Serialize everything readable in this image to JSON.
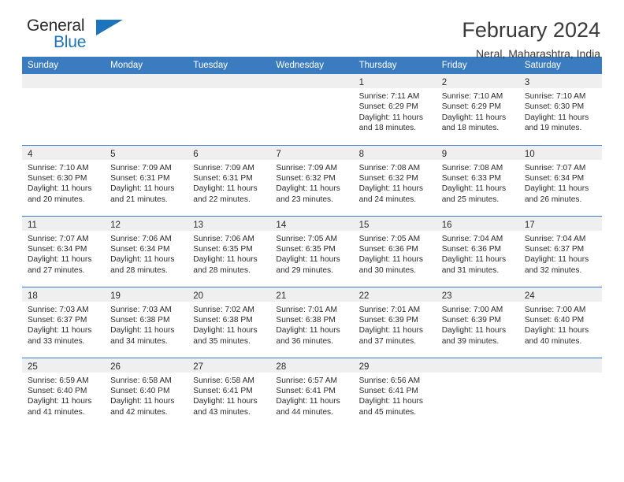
{
  "brand": {
    "name_part1": "General",
    "name_part2": "Blue"
  },
  "header": {
    "title": "February 2024",
    "subtitle": "Neral, Maharashtra, India"
  },
  "colors": {
    "header_blue": "#3b7cc0",
    "daynum_band": "#efefef",
    "brand_blue": "#1c75bc",
    "text": "#2b2b2b"
  },
  "weekday_headers": [
    "Sunday",
    "Monday",
    "Tuesday",
    "Wednesday",
    "Thursday",
    "Friday",
    "Saturday"
  ],
  "weeks": [
    [
      {
        "empty": true
      },
      {
        "empty": true
      },
      {
        "empty": true
      },
      {
        "empty": true
      },
      {
        "day": "1",
        "sunrise": "Sunrise: 7:11 AM",
        "sunset": "Sunset: 6:29 PM",
        "daylight1": "Daylight: 11 hours",
        "daylight2": "and 18 minutes."
      },
      {
        "day": "2",
        "sunrise": "Sunrise: 7:10 AM",
        "sunset": "Sunset: 6:29 PM",
        "daylight1": "Daylight: 11 hours",
        "daylight2": "and 18 minutes."
      },
      {
        "day": "3",
        "sunrise": "Sunrise: 7:10 AM",
        "sunset": "Sunset: 6:30 PM",
        "daylight1": "Daylight: 11 hours",
        "daylight2": "and 19 minutes."
      }
    ],
    [
      {
        "day": "4",
        "sunrise": "Sunrise: 7:10 AM",
        "sunset": "Sunset: 6:30 PM",
        "daylight1": "Daylight: 11 hours",
        "daylight2": "and 20 minutes."
      },
      {
        "day": "5",
        "sunrise": "Sunrise: 7:09 AM",
        "sunset": "Sunset: 6:31 PM",
        "daylight1": "Daylight: 11 hours",
        "daylight2": "and 21 minutes."
      },
      {
        "day": "6",
        "sunrise": "Sunrise: 7:09 AM",
        "sunset": "Sunset: 6:31 PM",
        "daylight1": "Daylight: 11 hours",
        "daylight2": "and 22 minutes."
      },
      {
        "day": "7",
        "sunrise": "Sunrise: 7:09 AM",
        "sunset": "Sunset: 6:32 PM",
        "daylight1": "Daylight: 11 hours",
        "daylight2": "and 23 minutes."
      },
      {
        "day": "8",
        "sunrise": "Sunrise: 7:08 AM",
        "sunset": "Sunset: 6:32 PM",
        "daylight1": "Daylight: 11 hours",
        "daylight2": "and 24 minutes."
      },
      {
        "day": "9",
        "sunrise": "Sunrise: 7:08 AM",
        "sunset": "Sunset: 6:33 PM",
        "daylight1": "Daylight: 11 hours",
        "daylight2": "and 25 minutes."
      },
      {
        "day": "10",
        "sunrise": "Sunrise: 7:07 AM",
        "sunset": "Sunset: 6:34 PM",
        "daylight1": "Daylight: 11 hours",
        "daylight2": "and 26 minutes."
      }
    ],
    [
      {
        "day": "11",
        "sunrise": "Sunrise: 7:07 AM",
        "sunset": "Sunset: 6:34 PM",
        "daylight1": "Daylight: 11 hours",
        "daylight2": "and 27 minutes."
      },
      {
        "day": "12",
        "sunrise": "Sunrise: 7:06 AM",
        "sunset": "Sunset: 6:34 PM",
        "daylight1": "Daylight: 11 hours",
        "daylight2": "and 28 minutes."
      },
      {
        "day": "13",
        "sunrise": "Sunrise: 7:06 AM",
        "sunset": "Sunset: 6:35 PM",
        "daylight1": "Daylight: 11 hours",
        "daylight2": "and 28 minutes."
      },
      {
        "day": "14",
        "sunrise": "Sunrise: 7:05 AM",
        "sunset": "Sunset: 6:35 PM",
        "daylight1": "Daylight: 11 hours",
        "daylight2": "and 29 minutes."
      },
      {
        "day": "15",
        "sunrise": "Sunrise: 7:05 AM",
        "sunset": "Sunset: 6:36 PM",
        "daylight1": "Daylight: 11 hours",
        "daylight2": "and 30 minutes."
      },
      {
        "day": "16",
        "sunrise": "Sunrise: 7:04 AM",
        "sunset": "Sunset: 6:36 PM",
        "daylight1": "Daylight: 11 hours",
        "daylight2": "and 31 minutes."
      },
      {
        "day": "17",
        "sunrise": "Sunrise: 7:04 AM",
        "sunset": "Sunset: 6:37 PM",
        "daylight1": "Daylight: 11 hours",
        "daylight2": "and 32 minutes."
      }
    ],
    [
      {
        "day": "18",
        "sunrise": "Sunrise: 7:03 AM",
        "sunset": "Sunset: 6:37 PM",
        "daylight1": "Daylight: 11 hours",
        "daylight2": "and 33 minutes."
      },
      {
        "day": "19",
        "sunrise": "Sunrise: 7:03 AM",
        "sunset": "Sunset: 6:38 PM",
        "daylight1": "Daylight: 11 hours",
        "daylight2": "and 34 minutes."
      },
      {
        "day": "20",
        "sunrise": "Sunrise: 7:02 AM",
        "sunset": "Sunset: 6:38 PM",
        "daylight1": "Daylight: 11 hours",
        "daylight2": "and 35 minutes."
      },
      {
        "day": "21",
        "sunrise": "Sunrise: 7:01 AM",
        "sunset": "Sunset: 6:38 PM",
        "daylight1": "Daylight: 11 hours",
        "daylight2": "and 36 minutes."
      },
      {
        "day": "22",
        "sunrise": "Sunrise: 7:01 AM",
        "sunset": "Sunset: 6:39 PM",
        "daylight1": "Daylight: 11 hours",
        "daylight2": "and 37 minutes."
      },
      {
        "day": "23",
        "sunrise": "Sunrise: 7:00 AM",
        "sunset": "Sunset: 6:39 PM",
        "daylight1": "Daylight: 11 hours",
        "daylight2": "and 39 minutes."
      },
      {
        "day": "24",
        "sunrise": "Sunrise: 7:00 AM",
        "sunset": "Sunset: 6:40 PM",
        "daylight1": "Daylight: 11 hours",
        "daylight2": "and 40 minutes."
      }
    ],
    [
      {
        "day": "25",
        "sunrise": "Sunrise: 6:59 AM",
        "sunset": "Sunset: 6:40 PM",
        "daylight1": "Daylight: 11 hours",
        "daylight2": "and 41 minutes."
      },
      {
        "day": "26",
        "sunrise": "Sunrise: 6:58 AM",
        "sunset": "Sunset: 6:40 PM",
        "daylight1": "Daylight: 11 hours",
        "daylight2": "and 42 minutes."
      },
      {
        "day": "27",
        "sunrise": "Sunrise: 6:58 AM",
        "sunset": "Sunset: 6:41 PM",
        "daylight1": "Daylight: 11 hours",
        "daylight2": "and 43 minutes."
      },
      {
        "day": "28",
        "sunrise": "Sunrise: 6:57 AM",
        "sunset": "Sunset: 6:41 PM",
        "daylight1": "Daylight: 11 hours",
        "daylight2": "and 44 minutes."
      },
      {
        "day": "29",
        "sunrise": "Sunrise: 6:56 AM",
        "sunset": "Sunset: 6:41 PM",
        "daylight1": "Daylight: 11 hours",
        "daylight2": "and 45 minutes."
      },
      {
        "empty": true
      },
      {
        "empty": true
      }
    ]
  ]
}
